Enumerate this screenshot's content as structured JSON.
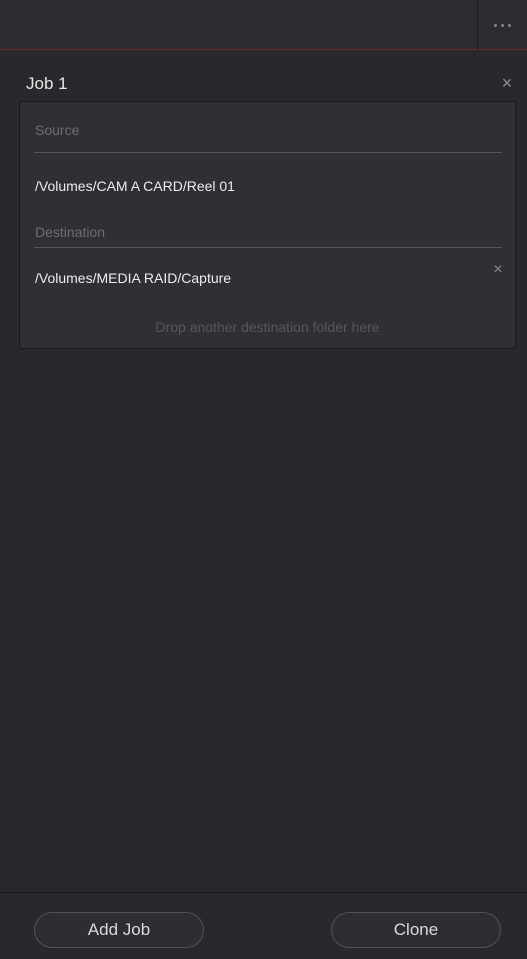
{
  "header": {
    "more_icon": "more-horizontal-icon"
  },
  "job": {
    "title": "Job 1",
    "close_icon": "close-icon",
    "source_label": "Source",
    "source_path": "/Volumes/CAM A CARD/Reel 01",
    "destination_label": "Destination",
    "destinations": [
      {
        "path": "/Volumes/MEDIA RAID/Capture",
        "remove_icon": "close-icon"
      }
    ],
    "drop_hint": "Drop another destination folder here"
  },
  "footer": {
    "add_job_label": "Add Job",
    "clone_label": "Clone"
  },
  "colors": {
    "background": "#28292d",
    "card": "#2f3034",
    "accent_line": "#6e2a26",
    "text_primary": "#ececec",
    "text_muted": "#6c6e73"
  }
}
